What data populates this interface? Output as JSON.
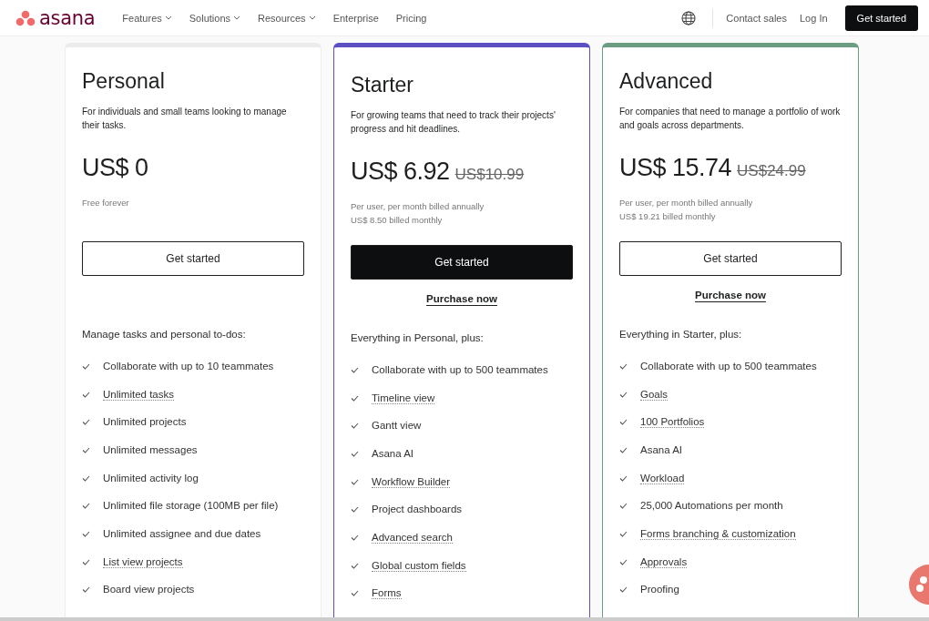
{
  "nav": {
    "brand": "asana",
    "menu": [
      {
        "label": "Features",
        "dropdown": true
      },
      {
        "label": "Solutions",
        "dropdown": true
      },
      {
        "label": "Resources",
        "dropdown": true
      },
      {
        "label": "Enterprise",
        "dropdown": false
      },
      {
        "label": "Pricing",
        "dropdown": false
      }
    ],
    "contact": "Contact sales",
    "login": "Log In",
    "cta": "Get started"
  },
  "plans": [
    {
      "name": "Personal",
      "color": "#ececec",
      "description": "For individuals and small teams looking to manage their tasks.",
      "price": "US$ 0",
      "notes": [
        "Free forever"
      ],
      "button": {
        "label": "Get started",
        "kind": "outline"
      },
      "features_heading": "Manage tasks and personal to-dos:",
      "features": [
        {
          "text": "Collaborate with up to 10 teammates",
          "linked": false
        },
        {
          "text": "Unlimited tasks",
          "linked": true
        },
        {
          "text": "Unlimited projects",
          "linked": false
        },
        {
          "text": "Unlimited messages",
          "linked": false
        },
        {
          "text": "Unlimited activity log",
          "linked": false
        },
        {
          "text": "Unlimited file storage (100MB per file)",
          "linked": false
        },
        {
          "text": "Unlimited assignee and due dates",
          "linked": false
        },
        {
          "text": "List view projects",
          "linked": true
        },
        {
          "text": "Board view projects",
          "linked": false
        }
      ]
    },
    {
      "name": "Starter",
      "color": "#5b4fc4",
      "description": "For growing teams that need to track their projects' progress and hit deadlines.",
      "price": "US$ 6.92",
      "old_price": "US$10.99",
      "notes": [
        "Per user, per month billed annually",
        "US$ 8.50 billed monthly"
      ],
      "button": {
        "label": "Get started",
        "kind": "solid"
      },
      "purchase": "Purchase now",
      "features_heading": "Everything in Personal, plus:",
      "features": [
        {
          "text": "Collaborate with up to 500 teammates",
          "linked": false
        },
        {
          "text": "Timeline view",
          "linked": true
        },
        {
          "text": "Gantt view",
          "linked": false
        },
        {
          "text": "Asana AI",
          "linked": false
        },
        {
          "text": "Workflow Builder",
          "linked": true
        },
        {
          "text": "Project dashboards",
          "linked": false
        },
        {
          "text": "Advanced search",
          "linked": true
        },
        {
          "text": "Global custom fields",
          "linked": true
        },
        {
          "text": "Forms",
          "linked": true
        }
      ]
    },
    {
      "name": "Advanced",
      "color": "#6b9e80",
      "description": "For companies that need to manage a portfolio of work and goals across departments.",
      "price": "US$ 15.74",
      "old_price": "US$24.99",
      "notes": [
        "Per user, per month billed annually",
        "US$ 19.21 billed monthly"
      ],
      "button": {
        "label": "Get started",
        "kind": "outline"
      },
      "purchase": "Purchase now",
      "features_heading": "Everything in Starter, plus:",
      "features": [
        {
          "text": "Collaborate with up to 500 teammates",
          "linked": false
        },
        {
          "text": "Goals",
          "linked": true
        },
        {
          "text": "100 Portfolios",
          "linked": true
        },
        {
          "text": "Asana AI",
          "linked": false
        },
        {
          "text": "Workload",
          "linked": true
        },
        {
          "text": "25,000 Automations per month",
          "linked": false
        },
        {
          "text": "Forms branching & customization",
          "linked": true
        },
        {
          "text": "Approvals",
          "linked": true
        },
        {
          "text": "Proofing",
          "linked": false
        }
      ]
    }
  ]
}
